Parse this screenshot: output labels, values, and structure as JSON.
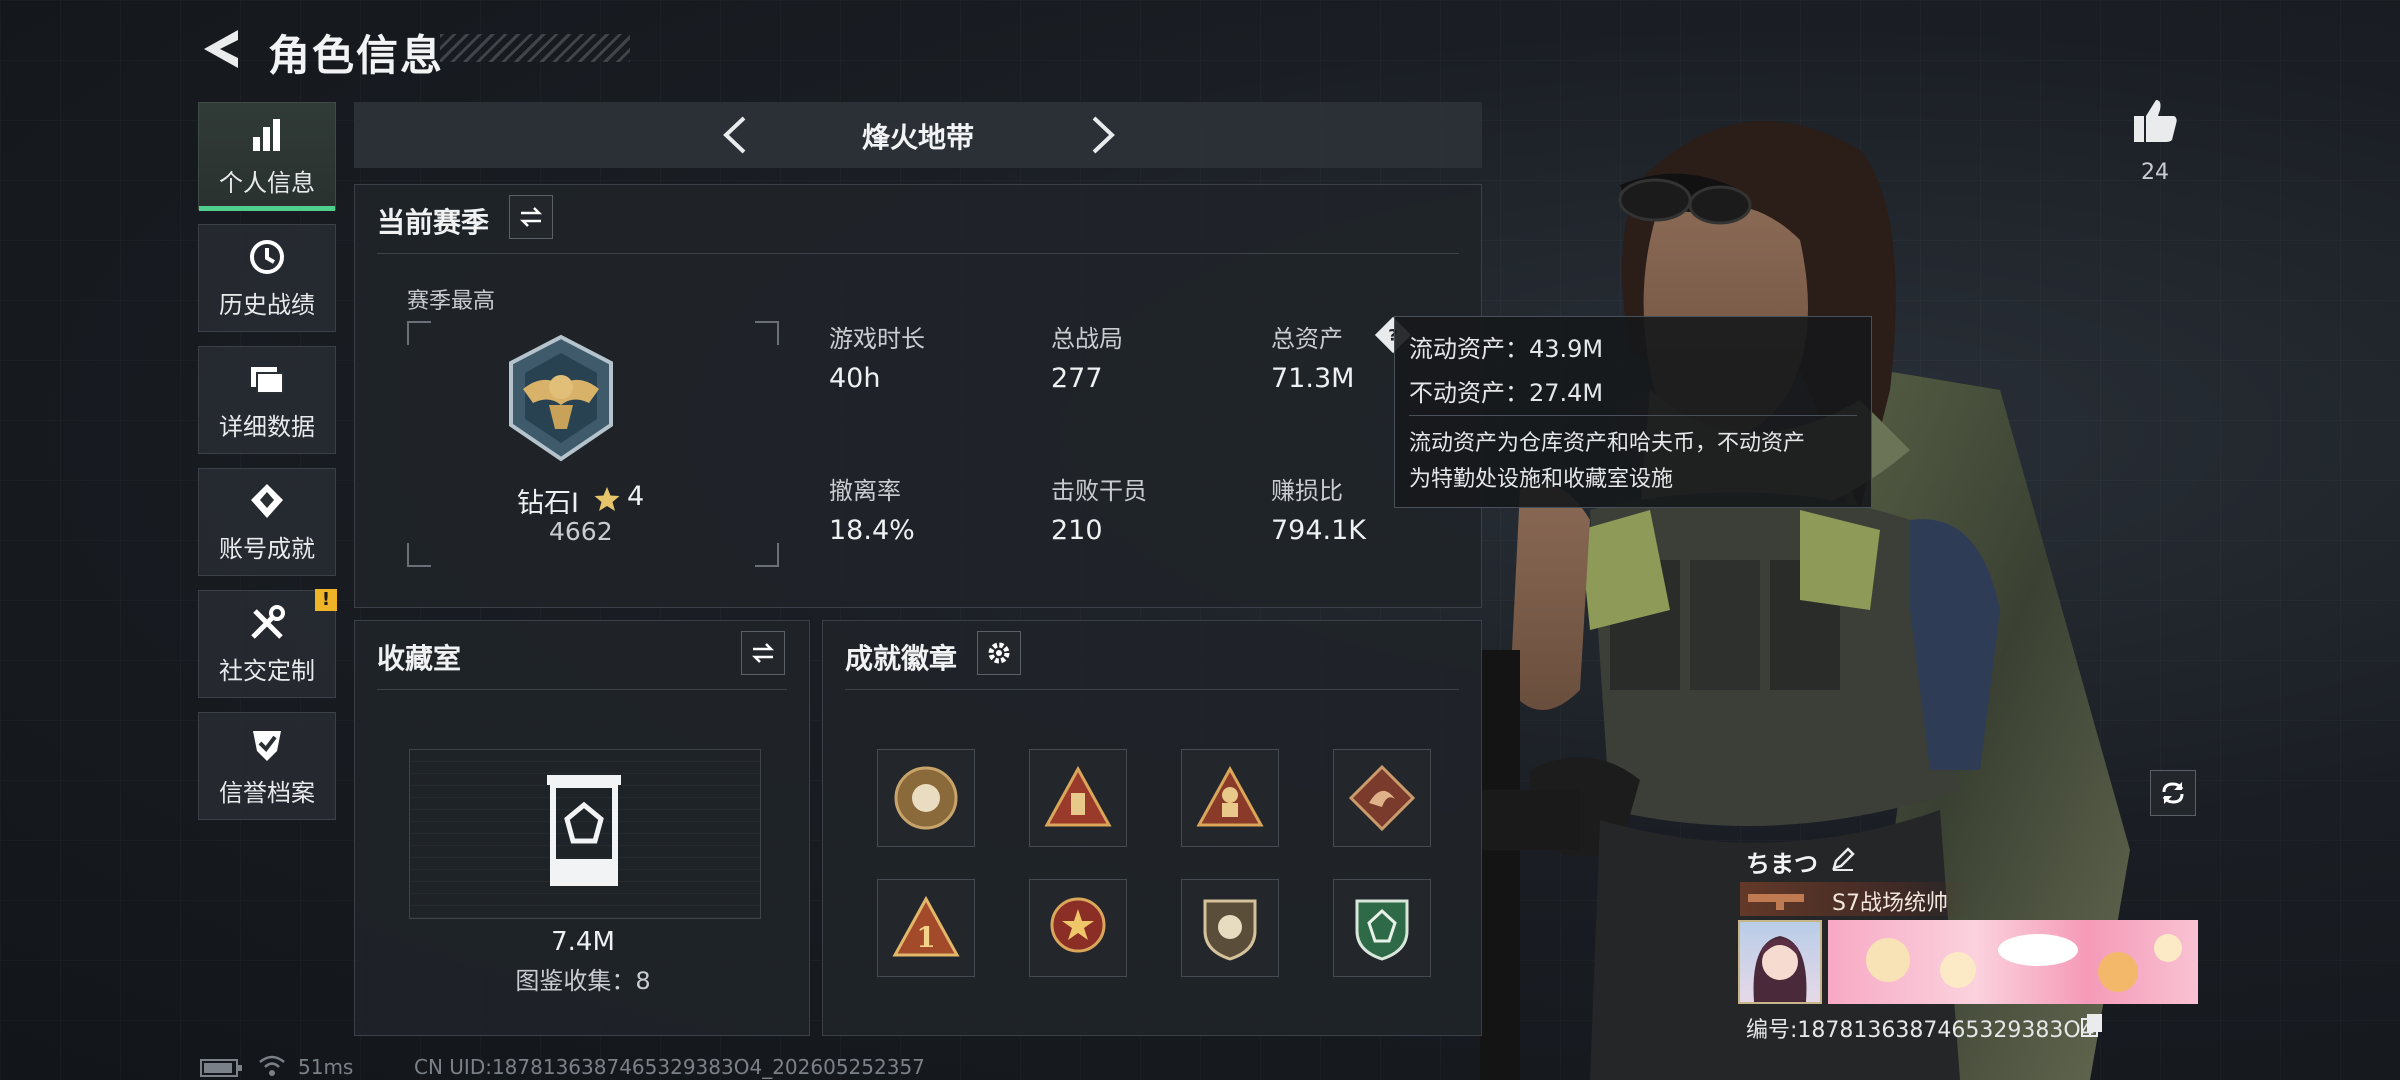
{
  "header": {
    "title": "角色信息"
  },
  "nav": {
    "items": [
      {
        "label": "个人信息",
        "icon": "bar-chart-icon",
        "active": true
      },
      {
        "label": "历史战绩",
        "icon": "history-clock-icon"
      },
      {
        "label": "详细数据",
        "icon": "folders-icon"
      },
      {
        "label": "账号成就",
        "icon": "achievement-icon"
      },
      {
        "label": "社交定制",
        "icon": "tools-icon",
        "badge": "!"
      },
      {
        "label": "信誉档案",
        "icon": "shield-check-icon"
      }
    ]
  },
  "mode": {
    "title": "烽火地带"
  },
  "season": {
    "title": "当前赛季",
    "best_label": "赛季最高",
    "rank_name": "钻石Ⅰ",
    "rank_stars": "4",
    "rank_score": "4662",
    "stats": [
      {
        "label": "游戏时长",
        "value": "40h"
      },
      {
        "label": "总战局",
        "value": "277"
      },
      {
        "label": "总资产",
        "value": "71.3M"
      },
      {
        "label": "撤离率",
        "value": "18.4%"
      },
      {
        "label": "击败干员",
        "value": "210"
      },
      {
        "label": "赚损比",
        "value": "794.1K"
      }
    ]
  },
  "tooltip": {
    "liquid": "流动资产：43.9M",
    "fixed": "不动资产：27.4M",
    "desc_1": "流动资产为仓库资产和哈夫币，不动资产",
    "desc_2": "为特勤处设施和收藏室设施"
  },
  "collection": {
    "title": "收藏室",
    "value": "7.4M",
    "count": "图鉴收集：8"
  },
  "badges": {
    "title": "成就徽章",
    "items": [
      "sun-badge-icon",
      "pyramid-badge-icon",
      "soldier-badge-icon",
      "dragon-badge-icon",
      "number-one-badge-icon",
      "star-wreath-badge-icon",
      "shield-badge-icon",
      "green-crest-badge-icon"
    ]
  },
  "profile": {
    "likes": "24",
    "name": "ちまつ",
    "title": "S7战场统帅",
    "id": "编号:1878136387465329383O4"
  },
  "status": {
    "ping": "51ms",
    "uid": "CN UID:1878136387465329383O4_202605252357"
  },
  "colors": {
    "accent": "#4ed08c",
    "warning": "#f0b429"
  }
}
